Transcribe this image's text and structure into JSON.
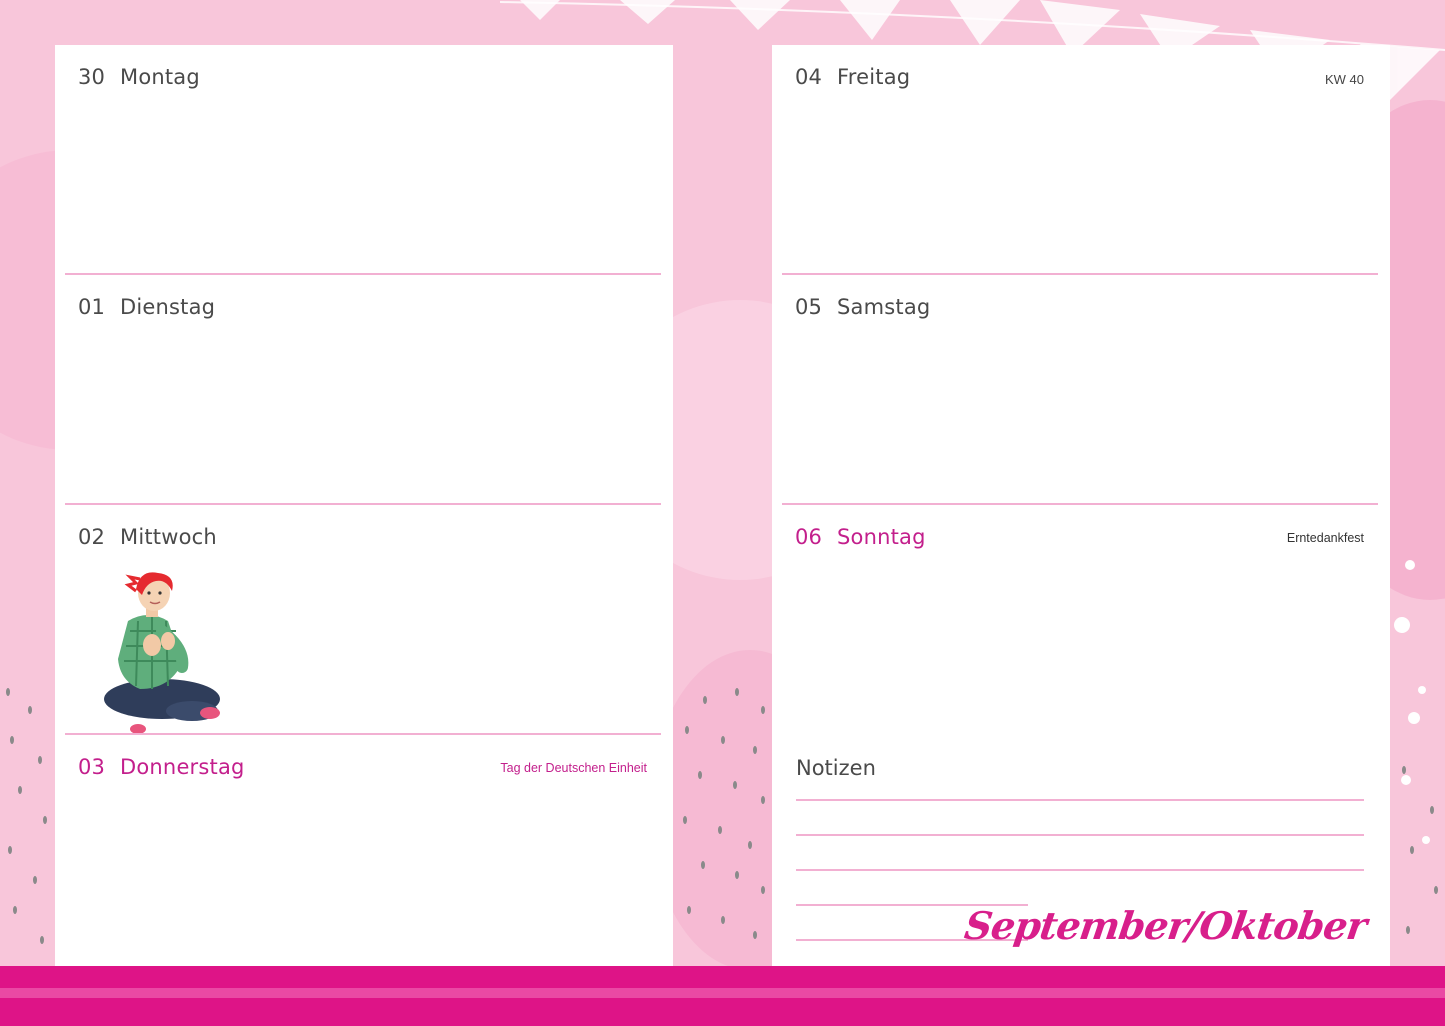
{
  "left_page": {
    "days": [
      {
        "num": "30",
        "name": "Montag",
        "note": ""
      },
      {
        "num": "01",
        "name": "Dienstag",
        "note": ""
      },
      {
        "num": "02",
        "name": "Mittwoch",
        "note": ""
      },
      {
        "num": "03",
        "name": "Donnerstag",
        "note": "Tag der Deutschen Einheit"
      }
    ]
  },
  "right_page": {
    "week_label": "KW 40",
    "days": [
      {
        "num": "04",
        "name": "Freitag",
        "note": ""
      },
      {
        "num": "05",
        "name": "Samstag",
        "note": ""
      },
      {
        "num": "06",
        "name": "Sonntag",
        "note": "Erntedankfest"
      }
    ],
    "notes_label": "Notizen",
    "month_label": "September/Oktober"
  },
  "colors": {
    "accent": "#de1487",
    "holiday_text": "#c31f8c",
    "rule": "#f2b0d2",
    "background": "#f8c6da"
  },
  "illustrations": [
    "girl-sitting-illustration",
    "pennant-bunting-decoration",
    "dot-pattern-decoration"
  ]
}
